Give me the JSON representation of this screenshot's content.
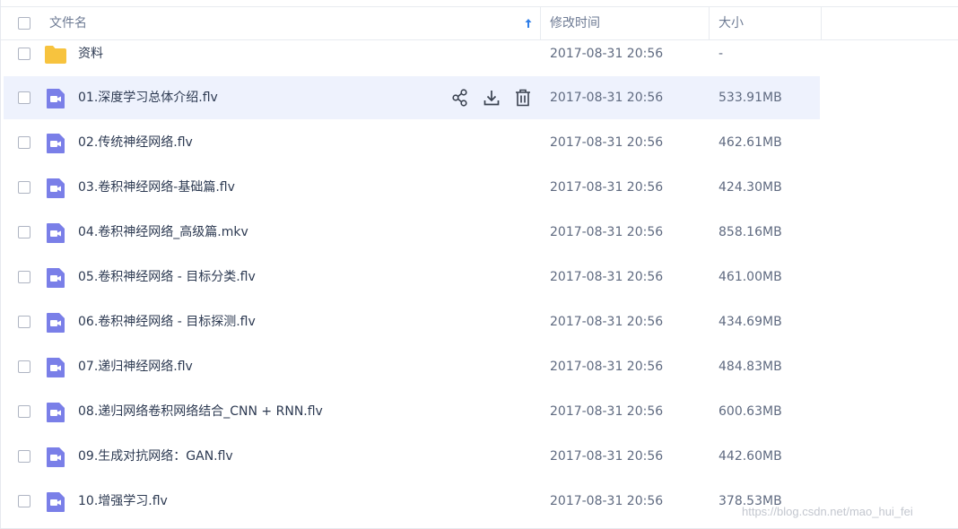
{
  "header": {
    "col_name": "文件名",
    "col_modified": "修改时间",
    "col_size": "大小"
  },
  "rows": [
    {
      "name": "资料",
      "date": "2017-08-31 20:56",
      "size": "-",
      "type": "folder"
    },
    {
      "name": "01.深度学习总体介绍.flv",
      "date": "2017-08-31 20:56",
      "size": "533.91MB",
      "type": "video"
    },
    {
      "name": "02.传统神经网络.flv",
      "date": "2017-08-31 20:56",
      "size": "462.61MB",
      "type": "video"
    },
    {
      "name": "03.卷积神经网络-基础篇.flv",
      "date": "2017-08-31 20:56",
      "size": "424.30MB",
      "type": "video"
    },
    {
      "name": "04.卷积神经网络_高级篇.mkv",
      "date": "2017-08-31 20:56",
      "size": "858.16MB",
      "type": "video"
    },
    {
      "name": "05.卷积神经网络 - 目标分类.flv",
      "date": "2017-08-31 20:56",
      "size": "461.00MB",
      "type": "video"
    },
    {
      "name": "06.卷积神经网络 - 目标探测.flv",
      "date": "2017-08-31 20:56",
      "size": "434.69MB",
      "type": "video"
    },
    {
      "name": "07.递归神经网络.flv",
      "date": "2017-08-31 20:56",
      "size": "484.83MB",
      "type": "video"
    },
    {
      "name": "08.递归网络卷积网络结合_CNN + RNN.flv",
      "date": "2017-08-31 20:56",
      "size": "600.63MB",
      "type": "video"
    },
    {
      "name": "09.生成对抗网络：GAN.flv",
      "date": "2017-08-31 20:56",
      "size": "442.60MB",
      "type": "video"
    },
    {
      "name": "10.增强学习.flv",
      "date": "2017-08-31 20:56",
      "size": "378.53MB",
      "type": "video"
    }
  ],
  "watermark": "https://blog.csdn.net/mao_hui_fei",
  "icons": {
    "folder": "folder-icon",
    "video": "video-file-icon",
    "share": "share-icon",
    "download": "download-icon",
    "delete": "trash-icon",
    "sort": "sort-ascending-icon"
  },
  "colors": {
    "folder": "#f7c33e",
    "video": "#7a7fe8",
    "row_hover": "#eef2fd",
    "sort_arrow": "#2f7ee8"
  }
}
